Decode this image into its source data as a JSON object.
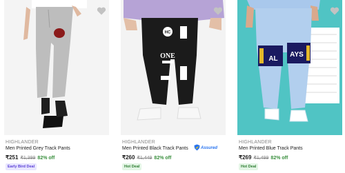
{
  "products": [
    {
      "brand": "HIGHLANDER",
      "name": "Men Printed Grey Track Pants",
      "price": "₹251",
      "mrp": "₹1,399",
      "discount": "82% off",
      "deal": "Early Bird Deal",
      "assured": ""
    },
    {
      "brand": "HIGHLANDER",
      "name": "Men Printed Black Track Pants",
      "price": "₹260",
      "mrp": "₹1,449",
      "discount": "82% off",
      "deal": "Hot Deal",
      "assured": "Assured"
    },
    {
      "brand": "HIGHLANDER",
      "name": "Men Printed Blue Track Pants",
      "price": "₹269",
      "mrp": "₹1,499",
      "discount": "82% off",
      "deal": "Hot Deal",
      "assured": ""
    }
  ],
  "colors": {
    "price": "#212121",
    "mrp": "#878787",
    "discount": "#388e3c",
    "early_bird_bg": "#e9e6ff",
    "early_bird_fg": "#5a3fd6",
    "hot_deal_bg": "#e3f5e5",
    "hot_deal_fg": "#2e7d32",
    "assured": "#2874f0",
    "wishlist": "#c2c2c2"
  },
  "icons": {
    "wishlist": "heart-icon",
    "assured": "assured-badge-icon"
  }
}
